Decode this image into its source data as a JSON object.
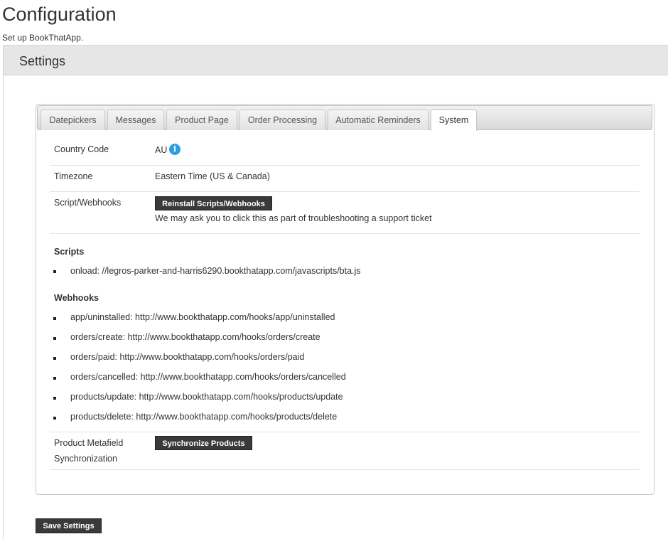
{
  "page": {
    "title": "Configuration",
    "subtitle": "Set up BookThatApp."
  },
  "settings": {
    "heading": "Settings"
  },
  "tabs": [
    {
      "label": "Datepickers"
    },
    {
      "label": "Messages"
    },
    {
      "label": "Product Page"
    },
    {
      "label": "Order Processing"
    },
    {
      "label": "Automatic Reminders"
    },
    {
      "label": "System"
    }
  ],
  "active_tab": "System",
  "system": {
    "country_code": {
      "label": "Country Code",
      "value": "AU",
      "icon": "info-icon"
    },
    "timezone": {
      "label": "Timezone",
      "value": "Eastern Time (US & Canada)"
    },
    "script_webhooks": {
      "label": "Script/Webhooks",
      "button": "Reinstall Scripts/Webhooks",
      "help": "We may ask you to click this as part of troubleshooting a support ticket"
    },
    "scripts": {
      "heading": "Scripts",
      "items": [
        "onload: //legros-parker-and-harris6290.bookthatapp.com/javascripts/bta.js"
      ]
    },
    "webhooks": {
      "heading": "Webhooks",
      "items": [
        "app/uninstalled: http://www.bookthatapp.com/hooks/app/uninstalled",
        "orders/create: http://www.bookthatapp.com/hooks/orders/create",
        "orders/paid: http://www.bookthatapp.com/hooks/orders/paid",
        "orders/cancelled: http://www.bookthatapp.com/hooks/orders/cancelled",
        "products/update: http://www.bookthatapp.com/hooks/products/update",
        "products/delete: http://www.bookthatapp.com/hooks/products/delete"
      ]
    },
    "metafield_sync": {
      "label_line1": "Product Metafield",
      "label_line2": "Synchronization",
      "button": "Synchronize Products"
    }
  },
  "footer": {
    "save_button": "Save Settings"
  },
  "colors": {
    "button_bg": "#3a3a3a",
    "info_icon": "#2d9fe0",
    "settings_bar": "#e6e6e6"
  }
}
